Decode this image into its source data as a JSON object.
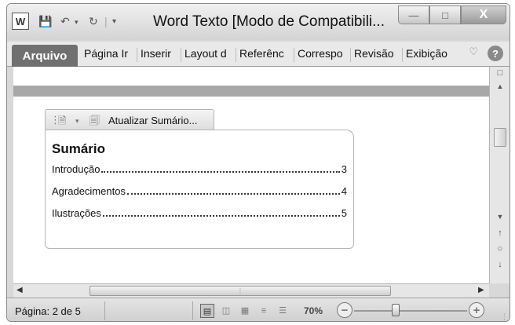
{
  "window": {
    "title": "Word Texto [Modo de Compatibili...",
    "app_icon": "W",
    "quick_access": {
      "save_icon": "save-icon",
      "undo_icon": "undo-icon",
      "redo_icon": "redo-icon",
      "customize_icon": "customize-dropdown-icon"
    },
    "controls": {
      "minimize": "—",
      "maximize": "□",
      "close": "X"
    }
  },
  "ribbon": {
    "tabs": [
      {
        "label": "Arquivo"
      },
      {
        "label": "Página Ir"
      },
      {
        "label": "Inserir"
      },
      {
        "label": "Layout d"
      },
      {
        "label": "Referênc"
      },
      {
        "label": "Correspo"
      },
      {
        "label": "Revisão"
      },
      {
        "label": "Exibição"
      }
    ],
    "help_label": "?"
  },
  "toc": {
    "update_label": "Atualizar Sumário...",
    "title": "Sumário",
    "entries": [
      {
        "label": "Introdução",
        "page": "3"
      },
      {
        "label": "Agradecimentos",
        "page": "4"
      },
      {
        "label": "Ilustrações",
        "page": "5"
      }
    ]
  },
  "statusbar": {
    "page_label": "Página: 2 de 5",
    "zoom_label": "70%",
    "zoom_minus": "−",
    "zoom_plus": "+",
    "zoom_percent": 70
  },
  "colors": {
    "file_tab": "#707070",
    "band": "#a8a8a8"
  }
}
